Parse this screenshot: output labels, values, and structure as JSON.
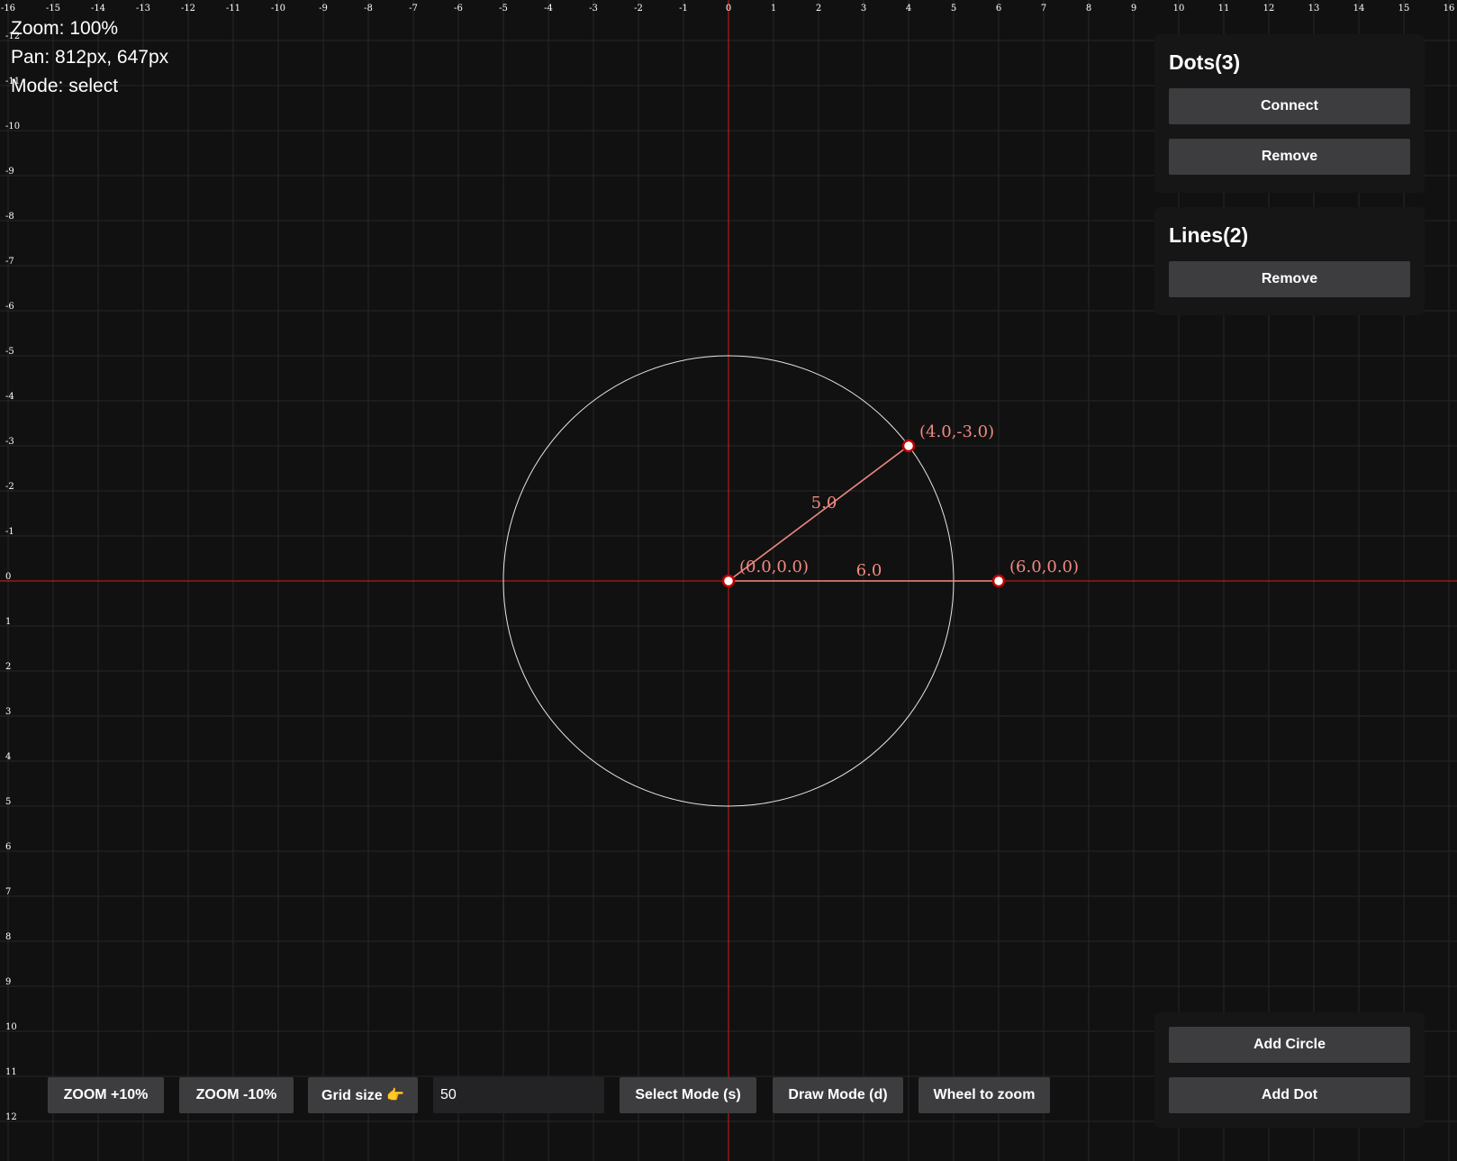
{
  "status": {
    "zoom": "Zoom: 100%",
    "pan": "Pan: 812px, 647px",
    "mode": "Mode: select"
  },
  "dots_panel": {
    "title": "Dots(3)",
    "connect_label": "Connect",
    "remove_label": "Remove"
  },
  "lines_panel": {
    "title": "Lines(2)",
    "remove_label": "Remove"
  },
  "add_panel": {
    "add_circle_label": "Add Circle",
    "add_dot_label": "Add Dot"
  },
  "toolbar": {
    "zoom_in_label": "ZOOM +10%",
    "zoom_out_label": "ZOOM -10%",
    "grid_size_label": "Grid size 👉",
    "grid_size_value": "50",
    "select_mode_label": "Select Mode (s)",
    "draw_mode_label": "Draw Mode (d)",
    "wheel_zoom_label": "Wheel to zoom"
  },
  "scene": {
    "unit": 50,
    "grid_range_x": [
      -16,
      16
    ],
    "grid_range_y": [
      -12,
      12
    ],
    "colors": {
      "background": "#111112",
      "grid": "#262628",
      "axis": "#b41a1a",
      "accent": "#f08a80",
      "circle": "#e6e6e6",
      "dot_fill": "#ffffff",
      "dot_stroke": "#c00000"
    },
    "dots": [
      {
        "x": 0,
        "y": 0,
        "label": "(0.0,0.0)"
      },
      {
        "x": 4,
        "y": -3,
        "label": "(4.0,-3.0)"
      },
      {
        "x": 6,
        "y": 0,
        "label": "(6.0,0.0)"
      }
    ],
    "lines": [
      {
        "from": 0,
        "to": 1,
        "length": "5.0"
      },
      {
        "from": 0,
        "to": 2,
        "length": "6.0"
      }
    ],
    "circles": [
      {
        "cx": 0,
        "cy": 0,
        "r": 5
      }
    ]
  }
}
